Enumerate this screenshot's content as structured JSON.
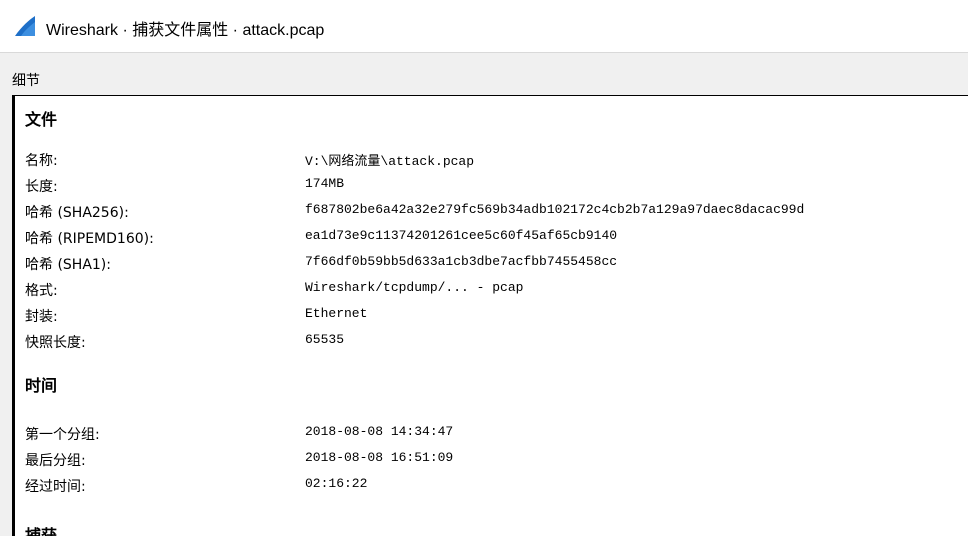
{
  "window": {
    "title": "Wireshark · 捕获文件属性 · attack.pcap",
    "icon": "wireshark-fin-icon",
    "accent": "#1e6fc8"
  },
  "details_label": "细节",
  "sections": {
    "file": {
      "heading": "文件",
      "rows": [
        {
          "label": "名称:",
          "value": "V:\\网络流量\\attack.pcap"
        },
        {
          "label": "长度:",
          "value": "174MB"
        },
        {
          "label": "哈希 (SHA256):",
          "value": "f687802be6a42a32e279fc569b34adb102172c4cb2b7a129a97daec8dacac99d"
        },
        {
          "label": "哈希 (RIPEMD160):",
          "value": "ea1d73e9c11374201261cee5c60f45af65cb9140"
        },
        {
          "label": "哈希 (SHA1):",
          "value": "7f66df0b59bb5d633a1cb3dbe7acfbb7455458cc"
        },
        {
          "label": "格式:",
          "value": "Wireshark/tcpdump/... - pcap"
        },
        {
          "label": "封装:",
          "value": "Ethernet"
        },
        {
          "label": "快照长度:",
          "value": "65535"
        }
      ]
    },
    "time": {
      "heading": "时间",
      "rows": [
        {
          "label": "第一个分组:",
          "value": "2018-08-08 14:34:47"
        },
        {
          "label": "最后分组:",
          "value": "2018-08-08 16:51:09"
        },
        {
          "label": "经过时间:",
          "value": "02:16:22"
        }
      ]
    },
    "capture": {
      "heading": "捕获"
    }
  }
}
